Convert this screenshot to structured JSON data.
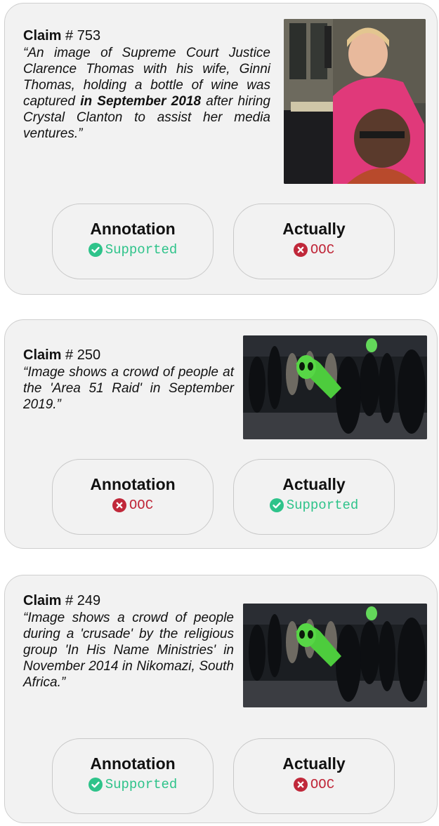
{
  "claims": [
    {
      "label": "Claim",
      "number": "# 753",
      "quote_pre": "“An image of Supreme Court Justice Clarence Thomas with his wife, Ginni Thomas, holding a bottle of wine was captured ",
      "quote_emph": "in September 2018",
      "quote_post": " after hiring Crystal Clanton to assist her media ventures.”",
      "annotation_title": "Annotation",
      "annotation_status": "Supported",
      "actually_title": "Actually",
      "actually_status": "OOC"
    },
    {
      "label": "Claim",
      "number": "# 250",
      "quote": "“Image shows a crowd of people at the 'Area 51 Raid' in September 2019.”",
      "annotation_title": "Annotation",
      "annotation_status": "OOC",
      "actually_title": "Actually",
      "actually_status": "Supported"
    },
    {
      "label": "Claim",
      "number": "# 249",
      "quote": "“Image shows a crowd of people during a 'crusade' by the religious group 'In His Name Ministries' in November 2014 in Nikomazi, South Africa.”",
      "annotation_title": "Annotation",
      "annotation_status": "Supported",
      "actually_title": "Actually",
      "actually_status": "OOC"
    }
  ],
  "colors": {
    "supported": "#2ec38a",
    "ooc": "#c0283a",
    "card_bg": "#f2f2f2"
  },
  "icons": {
    "supported": "check-circle-icon",
    "ooc": "x-circle-icon"
  }
}
